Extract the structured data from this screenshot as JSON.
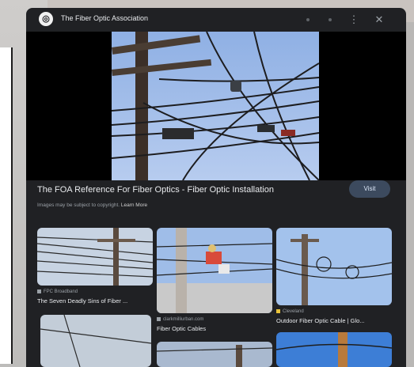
{
  "site": {
    "icon": "site-logo-icon",
    "name": "The Fiber Optic Association"
  },
  "toolbar": {
    "icons": [
      "share-icon",
      "bookmark-icon",
      "more-vert-icon",
      "close-icon"
    ],
    "more_glyph": "⋮",
    "close_glyph": "✕"
  },
  "main": {
    "title": "The FOA Reference For Fiber Optics - Fiber Optic Installation",
    "notice": "Images may be subject to copyright.",
    "learn_more": "Learn More",
    "visit_label": "Visit"
  },
  "related": [
    {
      "source": "FPC Broadband",
      "caption": "The Seven Deadly Sins of Fiber ..."
    },
    {
      "source": "clarkmilliurban.com",
      "caption": "Fiber Optic Cables"
    },
    {
      "source": "Cleveland",
      "caption": "Outdoor Fiber Optic Cable | Glo..."
    }
  ],
  "colors": {
    "panel": "#202124",
    "accent_button": "#3c4a5e",
    "sky": "#a9c3ea"
  }
}
